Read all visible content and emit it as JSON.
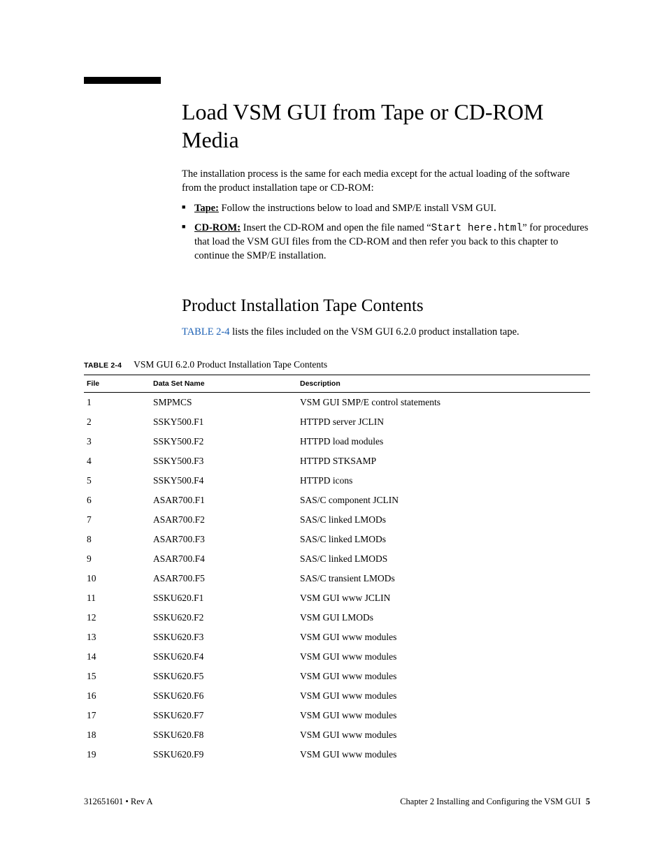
{
  "heading": "Load VSM GUI from Tape or CD-ROM Media",
  "intro": "The installation process is the same for each media except for the actual loading of the software from the product installation tape or CD-ROM:",
  "bullets": {
    "tape_label": "Tape:",
    "tape_text": " Follow the instructions below to load and SMP/E install VSM GUI.",
    "cd_label": "CD-ROM:",
    "cd_text_pre": " Insert the CD-ROM and open the file named “",
    "cd_file": "Start here.html",
    "cd_text_post": "” for procedures that load the VSM GUI files from the CD-ROM and then refer you back to this chapter to continue the SMP/E installation."
  },
  "subheading": "Product Installation Tape Contents",
  "sub_intro_pre": "",
  "table_link": "TABLE 2-4",
  "sub_intro_post": " lists the files included on the VSM GUI 6.2.0 product installation tape.",
  "table_caption_label": "TABLE 2-4",
  "table_caption_title": "VSM GUI 6.2.0 Product Installation Tape Contents",
  "columns": {
    "c1": "File",
    "c2": "Data Set Name",
    "c3": "Description"
  },
  "rows": [
    {
      "file": "1",
      "ds": "SMPMCS",
      "desc": "VSM GUI SMP/E control statements"
    },
    {
      "file": "2",
      "ds": "SSKY500.F1",
      "desc": "HTTPD server JCLIN"
    },
    {
      "file": "3",
      "ds": "SSKY500.F2",
      "desc": "HTTPD load modules"
    },
    {
      "file": "4",
      "ds": "SSKY500.F3",
      "desc": "HTTPD STKSAMP"
    },
    {
      "file": "5",
      "ds": "SSKY500.F4",
      "desc": "HTTPD icons"
    },
    {
      "file": "6",
      "ds": "ASAR700.F1",
      "desc": "SAS/C component JCLIN"
    },
    {
      "file": "7",
      "ds": "ASAR700.F2",
      "desc": "SAS/C linked LMODs"
    },
    {
      "file": "8",
      "ds": "ASAR700.F3",
      "desc": "SAS/C linked LMODs"
    },
    {
      "file": "9",
      "ds": "ASAR700.F4",
      "desc": "SAS/C linked LMODS"
    },
    {
      "file": "10",
      "ds": "ASAR700.F5",
      "desc": "SAS/C transient LMODs"
    },
    {
      "file": "11",
      "ds": "SSKU620.F1",
      "desc": "VSM GUI www JCLIN"
    },
    {
      "file": "12",
      "ds": "SSKU620.F2",
      "desc": "VSM GUI LMODs"
    },
    {
      "file": "13",
      "ds": "SSKU620.F3",
      "desc": "VSM GUI www modules"
    },
    {
      "file": "14",
      "ds": "SSKU620.F4",
      "desc": "VSM GUI www modules"
    },
    {
      "file": "15",
      "ds": "SSKU620.F5",
      "desc": "VSM GUI www modules"
    },
    {
      "file": "16",
      "ds": "SSKU620.F6",
      "desc": "VSM GUI www modules"
    },
    {
      "file": "17",
      "ds": "SSKU620.F7",
      "desc": "VSM GUI www modules"
    },
    {
      "file": "18",
      "ds": "SSKU620.F8",
      "desc": "VSM GUI www modules"
    },
    {
      "file": "19",
      "ds": "SSKU620.F9",
      "desc": "VSM GUI www modules"
    }
  ],
  "footer": {
    "left": "312651601 • Rev A",
    "right_text": "Chapter 2 Installing and Configuring the VSM GUI",
    "page_number": "5"
  }
}
